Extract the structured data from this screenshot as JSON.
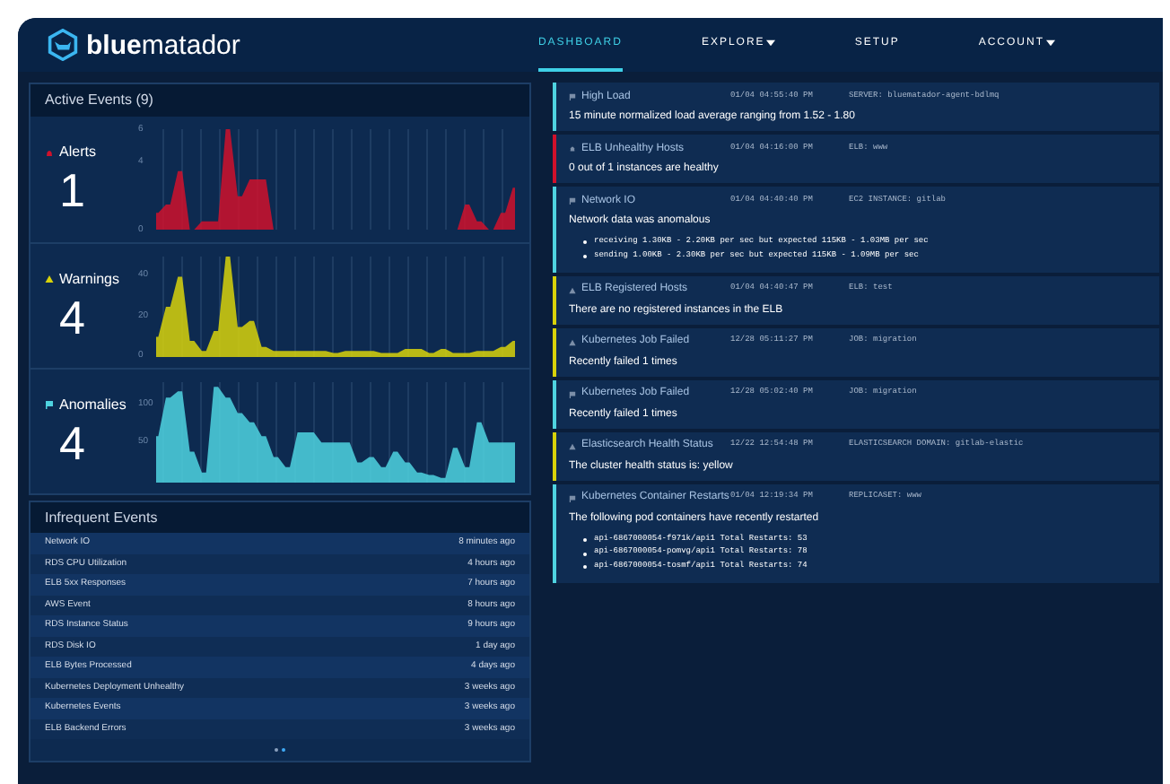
{
  "logo": {
    "bold": "blue",
    "light": "matador"
  },
  "nav": [
    {
      "label": "DASHBOARD",
      "selected": true,
      "dropdown": false
    },
    {
      "label": "EXPLORE",
      "selected": false,
      "dropdown": true
    },
    {
      "label": "SETUP",
      "selected": false,
      "dropdown": false
    },
    {
      "label": "ACCOUNT",
      "selected": false,
      "dropdown": true
    }
  ],
  "active_events": {
    "title": "Active Events (9)",
    "groups": [
      {
        "kind": "alert",
        "label": "Alerts",
        "count": "1",
        "chart_data": {
          "type": "area",
          "grid": true,
          "ylim": [
            0,
            6
          ],
          "yticks": [
            0,
            4,
            6
          ],
          "series": [
            {
              "color": "#d0112b",
              "values": [
                1,
                1.5,
                3.5,
                0,
                0.5,
                0.5,
                6,
                2,
                3,
                3,
                0,
                0,
                0,
                0,
                0,
                0,
                0,
                0,
                0,
                0,
                0,
                0,
                0,
                0,
                0,
                0,
                1.5,
                0.5,
                0,
                1,
                2.5
              ]
            }
          ]
        }
      },
      {
        "kind": "warning",
        "label": "Warnings",
        "count": "4",
        "chart_data": {
          "type": "area",
          "grid": true,
          "ylim": [
            0,
            50
          ],
          "yticks": [
            0,
            20,
            40
          ],
          "series": [
            {
              "color": "#d8d20a",
              "values": [
                10,
                25,
                40,
                8,
                3,
                13,
                50,
                15,
                18,
                5,
                3,
                3,
                3,
                3,
                3,
                2,
                3,
                3,
                3,
                2,
                2,
                4,
                4,
                2,
                4,
                2,
                2,
                3,
                3,
                5,
                8
              ]
            }
          ]
        }
      },
      {
        "kind": "anomaly",
        "label": "Anomalies",
        "count": "4",
        "chart_data": {
          "type": "area",
          "grid": true,
          "ylim": [
            0,
            130
          ],
          "yticks": [
            50,
            100
          ],
          "series": [
            {
              "color": "#4fd3e0",
              "values": [
                60,
                110,
                118,
                40,
                13,
                124,
                110,
                90,
                78,
                60,
                33,
                20,
                65,
                65,
                52,
                52,
                52,
                26,
                33,
                20,
                40,
                26,
                13,
                10,
                6,
                45,
                20,
                78,
                52,
                52,
                52
              ]
            }
          ]
        }
      }
    ]
  },
  "infrequent_events": {
    "title": "Infrequent Events",
    "rows": [
      {
        "name": "Network IO",
        "time": "8 minutes ago"
      },
      {
        "name": "RDS CPU Utilization",
        "time": "4 hours ago"
      },
      {
        "name": "ELB 5xx Responses",
        "time": "7 hours ago"
      },
      {
        "name": "AWS Event",
        "time": "8 hours ago"
      },
      {
        "name": "RDS Instance Status",
        "time": "9 hours ago"
      },
      {
        "name": "RDS Disk IO",
        "time": "1 day ago"
      },
      {
        "name": "ELB Bytes Processed",
        "time": "4 days ago"
      },
      {
        "name": "Kubernetes Deployment Unhealthy",
        "time": "3 weeks ago"
      },
      {
        "name": "Kubernetes Events",
        "time": "3 weeks ago"
      },
      {
        "name": "ELB Backend Errors",
        "time": "3 weeks ago"
      }
    ],
    "pages": [
      {
        "selected": false
      },
      {
        "selected": true
      }
    ]
  },
  "events": [
    {
      "kind": "anomaly",
      "title": "High Load",
      "time": "01/04 04:55:40 PM",
      "source": "SERVER: bluematador-agent-bdlmq",
      "message": "15 minute normalized load average ranging from 1.52 - 1.80"
    },
    {
      "kind": "alert",
      "title": "ELB Unhealthy Hosts",
      "time": "01/04 04:16:00 PM",
      "source": "ELB: www",
      "message": "0 out of 1 instances are healthy"
    },
    {
      "kind": "anomaly",
      "title": "Network IO",
      "time": "01/04 04:40:40 PM",
      "source": "EC2 INSTANCE: gitlab",
      "message": "Network data was anomalous",
      "bullets": [
        "receiving 1.30KB - 2.20KB per sec but expected 115KB - 1.03MB per sec",
        "sending 1.00KB - 2.30KB per sec but expected 115KB - 1.09MB per sec"
      ]
    },
    {
      "kind": "warning",
      "title": "ELB Registered Hosts",
      "time": "01/04 04:40:47 PM",
      "source": "ELB: test",
      "message": "There are no registered instances in the ELB"
    },
    {
      "kind": "warning",
      "title": "Kubernetes Job Failed",
      "time": "12/28 05:11:27 PM",
      "source": "JOB: migration",
      "message": "Recently failed 1 times"
    },
    {
      "kind": "anomaly",
      "title": "Kubernetes Job Failed",
      "time": "12/28 05:02:40 PM",
      "source": "JOB: migration",
      "message": "Recently failed 1 times"
    },
    {
      "kind": "warning",
      "title": "Elasticsearch Health Status",
      "time": "12/22 12:54:48 PM",
      "source": "ELASTICSEARCH DOMAIN: gitlab-elastic",
      "message": "The cluster health status is: yellow"
    },
    {
      "kind": "anomaly",
      "title": "Kubernetes Container Restarts",
      "time": "01/04 12:19:34 PM",
      "source": "REPLICASET: www",
      "message": "The following pod containers have recently restarted",
      "bullets": [
        "api-6867000054-f971k/api1 Total Restarts: 53",
        "api-6867000054-pomvg/api1 Total Restarts: 78",
        "api-6867000054-tosmf/api1 Total Restarts: 74"
      ]
    }
  ]
}
